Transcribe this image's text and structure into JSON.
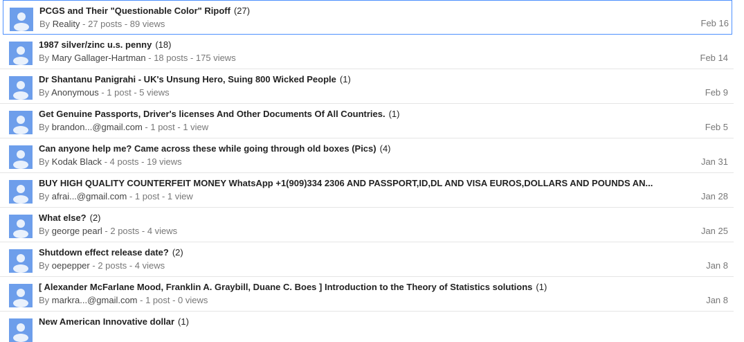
{
  "topics": [
    {
      "title": "PCGS and Their \"Questionable Color\" Ripoff",
      "count": "(27)",
      "by": "By",
      "author": "Reality",
      "stats": "- 27 posts - 89 views",
      "date": "Feb 16"
    },
    {
      "title": "1987 silver/zinc u.s. penny",
      "count": "(18)",
      "by": "By",
      "author": "Mary Gallager-Hartman",
      "stats": "- 18 posts - 175 views",
      "date": "Feb 14"
    },
    {
      "title": "Dr Shantanu Panigrahi - UK's Unsung Hero, Suing 800 Wicked People",
      "count": "(1)",
      "by": "By",
      "author": "Anonymous",
      "stats": "- 1 post - 5 views",
      "date": "Feb 9"
    },
    {
      "title": "Get Genuine Passports, Driver's licenses And Other Documents Of All Countries.",
      "count": "(1)",
      "by": "By",
      "author": "brandon...@gmail.com",
      "stats": "- 1 post - 1 view",
      "date": "Feb 5"
    },
    {
      "title": "Can anyone help me? Came across these while going through old boxes (Pics)",
      "count": "(4)",
      "by": "By",
      "author": "Kodak Black",
      "stats": "- 4 posts - 19 views",
      "date": "Jan 31"
    },
    {
      "title": "BUY HIGH QUALITY COUNTERFEIT MONEY WhatsApp +1(909)334 2306 AND PASSPORT,ID,DL AND VISA EUROS,DOLLARS AND POUNDS AN...",
      "count": "",
      "by": "By",
      "author": "afrai...@gmail.com",
      "stats": "- 1 post - 1 view",
      "date": "Jan 28"
    },
    {
      "title": "What else?",
      "count": "(2)",
      "by": "By",
      "author": "george pearl",
      "stats": "- 2 posts - 4 views",
      "date": "Jan 25"
    },
    {
      "title": "Shutdown effect release date?",
      "count": "(2)",
      "by": "By",
      "author": "oepepper",
      "stats": "- 2 posts - 4 views",
      "date": "Jan 8"
    },
    {
      "title": "[ Alexander McFarlane Mood, Franklin A. Graybill, Duane C. Boes ] Introduction to the Theory of Statistics solutions",
      "count": "(1)",
      "by": "By",
      "author": "markra...@gmail.com",
      "stats": "- 1 post - 0 views",
      "date": "Jan 8"
    }
  ],
  "partial_topic": {
    "title": "New American Innovative dollar",
    "count": "(1)"
  },
  "colors": {
    "avatar_bg": "#6d9eeb",
    "avatar_fg": "#ffffff",
    "selected_border": "#4d90fe"
  },
  "icons": {
    "avatar": "person-icon"
  }
}
